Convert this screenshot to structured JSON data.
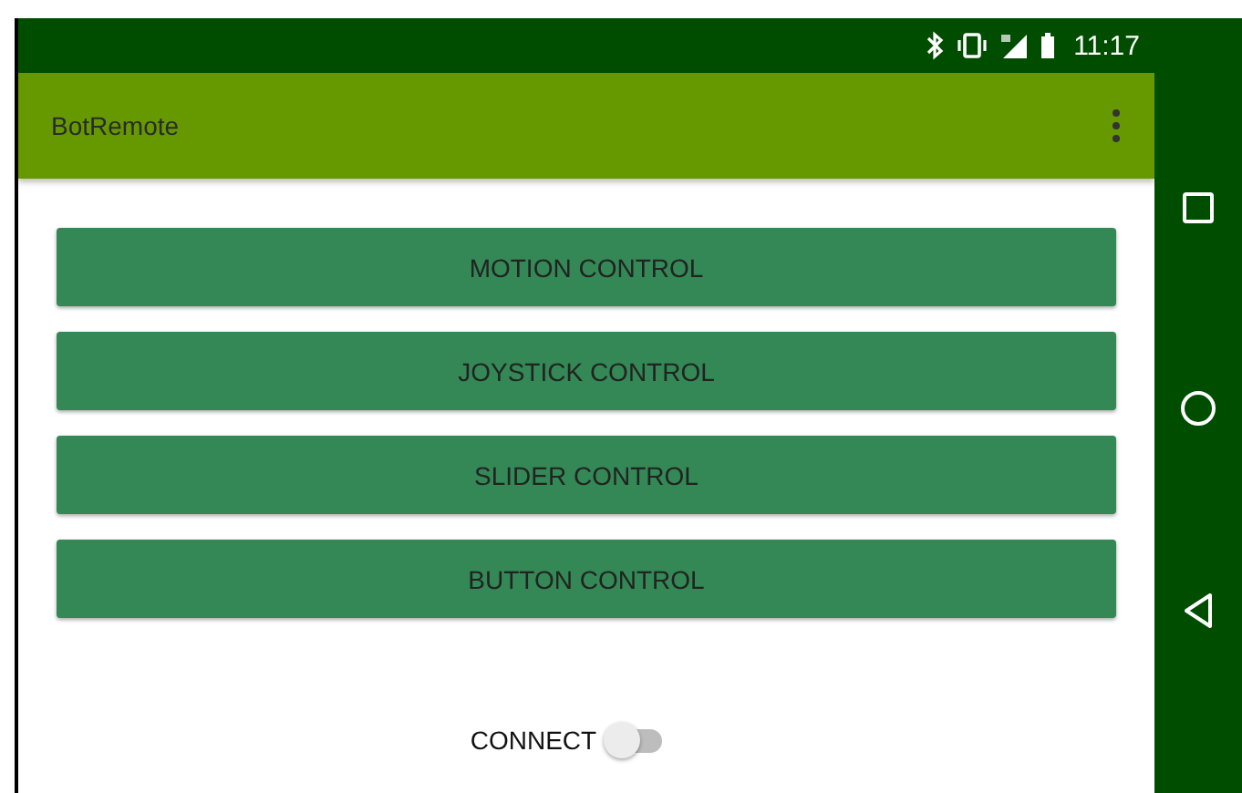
{
  "status_bar": {
    "time": "11:17"
  },
  "app_bar": {
    "title": "BotRemote"
  },
  "buttons": [
    {
      "label": "MOTION CONTROL"
    },
    {
      "label": "JOYSTICK CONTROL"
    },
    {
      "label": "SLIDER CONTROL"
    },
    {
      "label": "BUTTON CONTROL"
    }
  ],
  "connect": {
    "label": "CONNECT",
    "on": false
  }
}
